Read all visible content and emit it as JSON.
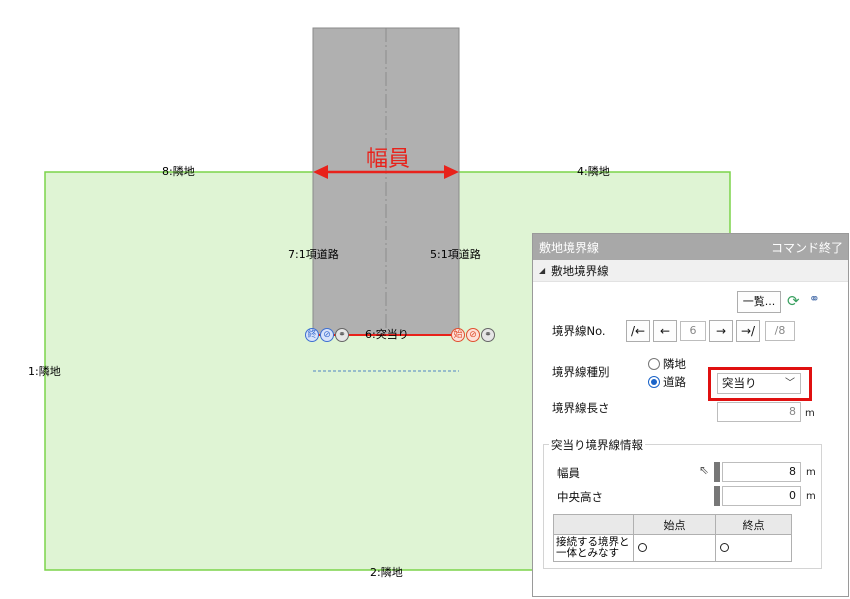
{
  "drawing": {
    "width_label": "幅員",
    "boundaries": {
      "b1": "1:隣地",
      "b2": "2:隣地",
      "b4": "4:隣地",
      "b5": "5:1項道路",
      "b6": "6:突当り",
      "b7": "7:1項道路",
      "b8": "8:隣地"
    },
    "end_marker": "終",
    "start_marker": "始",
    "colors": {
      "site_fill": "#dff4d4",
      "site_border": "#7bd44a",
      "road_fill": "#b0b0b0",
      "accent_red": "#e8221b"
    }
  },
  "panel": {
    "title": "敷地境界線",
    "end_command": "コマンド終了",
    "section_title": "敷地境界線",
    "list_button": "一覧...",
    "refresh_icon": "refresh-icon",
    "link_icon": "link-icon",
    "boundary_no_label": "境界線No.",
    "nav": {
      "first": "/←",
      "prev": "←",
      "current": "6",
      "next": "→",
      "last": "→/",
      "total": "/8"
    },
    "type_label": "境界線種別",
    "radio_neighbor": "隣地",
    "radio_road": "道路",
    "road_type_value": "突当り",
    "length_label": "境界線長さ",
    "length_value": "8",
    "unit_m": "m",
    "group_title": "突当り境界線情報",
    "width_label": "幅員",
    "width_value": "8",
    "center_height_label": "中央高さ",
    "center_height_value": "0",
    "table": {
      "col_start": "始点",
      "col_end": "終点",
      "row_label_line1": "接続する境界と",
      "row_label_line2": "一体とみなす"
    }
  }
}
